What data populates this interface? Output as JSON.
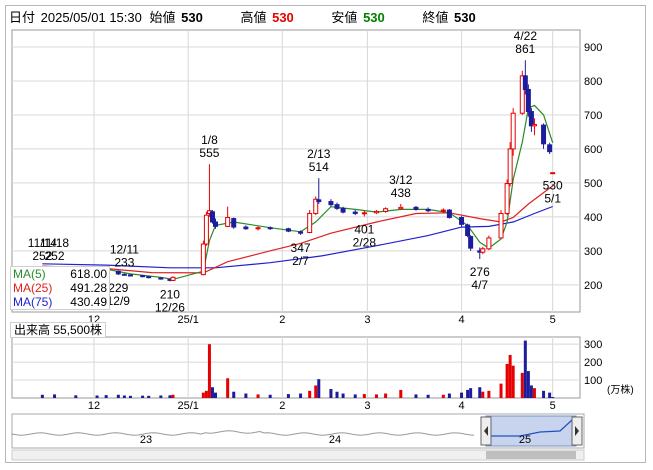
{
  "header": {
    "date_label": "日付",
    "date": "2025/05/01 15:30",
    "open_label": "始値",
    "open": "530",
    "high_label": "高値",
    "high": "530",
    "low_label": "安値",
    "low": "530",
    "close_label": "終値",
    "close": "530"
  },
  "colors": {
    "up": "#e60000",
    "down": "#1c1c9c",
    "ma5": "#2a8a2a",
    "ma25": "#e02020",
    "ma75": "#2020d0",
    "grid": "#d8d8d8",
    "volume_up": "#e60000",
    "volume_down": "#1c1c9c",
    "high_value": "#e60000",
    "low_value": "#008000"
  },
  "legend": [
    {
      "name": "MA(5)",
      "value": "618.00",
      "color": "#2a8a2a"
    },
    {
      "name": "MA(25)",
      "value": "491.28",
      "color": "#e02020"
    },
    {
      "name": "MA(75)",
      "value": "430.49",
      "color": "#2020d0"
    }
  ],
  "volume_title": "出来高 55,500株",
  "volume_unit": "(万株)",
  "navigator": {
    "labels": [
      "23",
      "24",
      "25"
    ]
  },
  "chart_data": [
    {
      "type": "candlestick",
      "title": "",
      "yticks": [
        200,
        300,
        400,
        500,
        600,
        700,
        800,
        900
      ],
      "ylim": [
        120,
        950
      ],
      "xticks": [
        {
          "label": "12",
          "x": "2024-12-01"
        },
        {
          "label": "25/1",
          "x": "2025-01-01"
        },
        {
          "label": "2",
          "x": "2025-02-01"
        },
        {
          "label": "3",
          "x": "2025-03-01"
        },
        {
          "label": "4",
          "x": "2025-04-01"
        },
        {
          "label": "5",
          "x": "2025-05-01"
        }
      ],
      "xlim": [
        "2024-11-04",
        "2025-05-10"
      ],
      "grid": true,
      "annotations": [
        {
          "date": "2024-11-14",
          "price": 252,
          "text": "11/14",
          "sub": "252"
        },
        {
          "date": "2024-11-18",
          "price": 252,
          "text": "11/18",
          "sub": "252"
        },
        {
          "date": "2024-12-11",
          "price": 233,
          "text": "12/11",
          "sub": "233"
        },
        {
          "date": "2024-12-09",
          "price": 229,
          "text": "229",
          "sub": "12/9"
        },
        {
          "date": "2024-12-26",
          "price": 210,
          "text": "210",
          "sub": "12/26"
        },
        {
          "date": "2025-01-08",
          "price": 555,
          "text": "1/8",
          "sub": "555"
        },
        {
          "date": "2025-02-07",
          "price": 347,
          "text": "347",
          "sub": "2/7"
        },
        {
          "date": "2025-02-13",
          "price": 514,
          "text": "2/13",
          "sub": "514"
        },
        {
          "date": "2025-02-28",
          "price": 401,
          "text": "401",
          "sub": "2/28"
        },
        {
          "date": "2025-03-12",
          "price": 438,
          "text": "3/12",
          "sub": "438"
        },
        {
          "date": "2025-04-07",
          "price": 276,
          "text": "276",
          "sub": "4/7"
        },
        {
          "date": "2025-04-22",
          "price": 861,
          "text": "4/22",
          "sub": "861"
        },
        {
          "date": "2025-05-01",
          "price": 530,
          "text": "530",
          "sub": "5/1"
        }
      ],
      "candles": [
        {
          "d": "2024-11-14",
          "o": 252,
          "h": 254,
          "l": 250,
          "c": 252
        },
        {
          "d": "2024-11-25",
          "o": 251,
          "h": 253,
          "l": 249,
          "c": 251
        },
        {
          "d": "2024-12-02",
          "o": 250,
          "h": 252,
          "l": 245,
          "c": 247
        },
        {
          "d": "2024-12-05",
          "o": 247,
          "h": 249,
          "l": 240,
          "c": 242
        },
        {
          "d": "2024-12-09",
          "o": 240,
          "h": 242,
          "l": 229,
          "c": 232
        },
        {
          "d": "2024-12-11",
          "o": 231,
          "h": 233,
          "l": 227,
          "c": 230
        },
        {
          "d": "2024-12-13",
          "o": 229,
          "h": 231,
          "l": 225,
          "c": 227
        },
        {
          "d": "2024-12-17",
          "o": 227,
          "h": 229,
          "l": 222,
          "c": 224
        },
        {
          "d": "2024-12-19",
          "o": 224,
          "h": 226,
          "l": 219,
          "c": 221
        },
        {
          "d": "2024-12-23",
          "o": 220,
          "h": 222,
          "l": 215,
          "c": 217
        },
        {
          "d": "2024-12-26",
          "o": 216,
          "h": 218,
          "l": 210,
          "c": 213
        },
        {
          "d": "2024-12-27",
          "o": 213,
          "h": 225,
          "l": 211,
          "c": 222
        },
        {
          "d": "2025-01-06",
          "o": 230,
          "h": 330,
          "l": 228,
          "c": 320
        },
        {
          "d": "2025-01-07",
          "o": 320,
          "h": 415,
          "l": 315,
          "c": 405
        },
        {
          "d": "2025-01-08",
          "o": 410,
          "h": 555,
          "l": 400,
          "c": 418
        },
        {
          "d": "2025-01-09",
          "o": 415,
          "h": 420,
          "l": 380,
          "c": 385
        },
        {
          "d": "2025-01-10",
          "o": 385,
          "h": 395,
          "l": 365,
          "c": 372
        },
        {
          "d": "2025-01-14",
          "o": 372,
          "h": 430,
          "l": 370,
          "c": 398
        },
        {
          "d": "2025-01-16",
          "o": 395,
          "h": 398,
          "l": 365,
          "c": 370
        },
        {
          "d": "2025-01-20",
          "o": 370,
          "h": 375,
          "l": 362,
          "c": 365
        },
        {
          "d": "2025-01-24",
          "o": 365,
          "h": 372,
          "l": 360,
          "c": 368
        },
        {
          "d": "2025-01-28",
          "o": 368,
          "h": 372,
          "l": 362,
          "c": 366
        },
        {
          "d": "2025-02-03",
          "o": 365,
          "h": 368,
          "l": 355,
          "c": 358
        },
        {
          "d": "2025-02-07",
          "o": 356,
          "h": 360,
          "l": 347,
          "c": 352
        },
        {
          "d": "2025-02-10",
          "o": 354,
          "h": 420,
          "l": 352,
          "c": 410
        },
        {
          "d": "2025-02-12",
          "o": 410,
          "h": 460,
          "l": 405,
          "c": 452
        },
        {
          "d": "2025-02-13",
          "o": 450,
          "h": 514,
          "l": 438,
          "c": 445
        },
        {
          "d": "2025-02-17",
          "o": 445,
          "h": 452,
          "l": 430,
          "c": 436
        },
        {
          "d": "2025-02-19",
          "o": 436,
          "h": 442,
          "l": 420,
          "c": 425
        },
        {
          "d": "2025-02-21",
          "o": 425,
          "h": 430,
          "l": 410,
          "c": 414
        },
        {
          "d": "2025-02-25",
          "o": 414,
          "h": 420,
          "l": 405,
          "c": 410
        },
        {
          "d": "2025-02-28",
          "o": 410,
          "h": 418,
          "l": 401,
          "c": 412
        },
        {
          "d": "2025-03-04",
          "o": 412,
          "h": 420,
          "l": 408,
          "c": 416
        },
        {
          "d": "2025-03-07",
          "o": 416,
          "h": 428,
          "l": 412,
          "c": 424
        },
        {
          "d": "2025-03-12",
          "o": 424,
          "h": 438,
          "l": 420,
          "c": 428
        },
        {
          "d": "2025-03-17",
          "o": 428,
          "h": 432,
          "l": 418,
          "c": 422
        },
        {
          "d": "2025-03-21",
          "o": 422,
          "h": 428,
          "l": 414,
          "c": 418
        },
        {
          "d": "2025-03-26",
          "o": 418,
          "h": 425,
          "l": 410,
          "c": 420
        },
        {
          "d": "2025-03-28",
          "o": 420,
          "h": 423,
          "l": 395,
          "c": 398
        },
        {
          "d": "2025-04-01",
          "o": 398,
          "h": 402,
          "l": 372,
          "c": 378
        },
        {
          "d": "2025-04-03",
          "o": 376,
          "h": 380,
          "l": 340,
          "c": 345
        },
        {
          "d": "2025-04-04",
          "o": 342,
          "h": 346,
          "l": 300,
          "c": 308
        },
        {
          "d": "2025-04-07",
          "o": 300,
          "h": 310,
          "l": 276,
          "c": 296
        },
        {
          "d": "2025-04-08",
          "o": 296,
          "h": 312,
          "l": 290,
          "c": 306
        },
        {
          "d": "2025-04-10",
          "o": 306,
          "h": 345,
          "l": 302,
          "c": 338
        },
        {
          "d": "2025-04-14",
          "o": 338,
          "h": 420,
          "l": 335,
          "c": 410
        },
        {
          "d": "2025-04-16",
          "o": 410,
          "h": 510,
          "l": 405,
          "c": 498
        },
        {
          "d": "2025-04-17",
          "o": 498,
          "h": 620,
          "l": 490,
          "c": 600
        },
        {
          "d": "2025-04-18",
          "o": 600,
          "h": 720,
          "l": 580,
          "c": 705
        },
        {
          "d": "2025-04-21",
          "o": 705,
          "h": 830,
          "l": 700,
          "c": 815
        },
        {
          "d": "2025-04-22",
          "o": 815,
          "h": 861,
          "l": 760,
          "c": 775
        },
        {
          "d": "2025-04-23",
          "o": 775,
          "h": 790,
          "l": 695,
          "c": 710
        },
        {
          "d": "2025-04-24",
          "o": 710,
          "h": 720,
          "l": 650,
          "c": 668
        },
        {
          "d": "2025-04-25",
          "o": 668,
          "h": 690,
          "l": 640,
          "c": 672
        },
        {
          "d": "2025-04-28",
          "o": 670,
          "h": 675,
          "l": 600,
          "c": 615
        },
        {
          "d": "2025-04-30",
          "o": 612,
          "h": 618,
          "l": 585,
          "c": 592
        },
        {
          "d": "2025-05-01",
          "o": 530,
          "h": 530,
          "l": 530,
          "c": 530
        }
      ],
      "ma5": [
        [
          "2024-11-14",
          252
        ],
        [
          "2024-12-05",
          246
        ],
        [
          "2024-12-13",
          232
        ],
        [
          "2024-12-23",
          222
        ],
        [
          "2024-12-27",
          216
        ],
        [
          "2025-01-06",
          240
        ],
        [
          "2025-01-08",
          330
        ],
        [
          "2025-01-10",
          375
        ],
        [
          "2025-01-16",
          385
        ],
        [
          "2025-01-28",
          368
        ],
        [
          "2025-02-07",
          356
        ],
        [
          "2025-02-12",
          385
        ],
        [
          "2025-02-17",
          430
        ],
        [
          "2025-02-25",
          422
        ],
        [
          "2025-03-04",
          414
        ],
        [
          "2025-03-12",
          422
        ],
        [
          "2025-03-21",
          422
        ],
        [
          "2025-03-28",
          412
        ],
        [
          "2025-04-03",
          375
        ],
        [
          "2025-04-07",
          325
        ],
        [
          "2025-04-10",
          308
        ],
        [
          "2025-04-14",
          335
        ],
        [
          "2025-04-16",
          385
        ],
        [
          "2025-04-18",
          510
        ],
        [
          "2025-04-21",
          620
        ],
        [
          "2025-04-23",
          720
        ],
        [
          "2025-04-25",
          728
        ],
        [
          "2025-04-28",
          700
        ],
        [
          "2025-05-01",
          618
        ]
      ],
      "ma25": [
        [
          "2024-11-14",
          255
        ],
        [
          "2024-12-05",
          248
        ],
        [
          "2024-12-20",
          236
        ],
        [
          "2025-01-06",
          235
        ],
        [
          "2025-01-14",
          268
        ],
        [
          "2025-01-28",
          300
        ],
        [
          "2025-02-07",
          322
        ],
        [
          "2025-02-17",
          352
        ],
        [
          "2025-03-04",
          385
        ],
        [
          "2025-03-17",
          410
        ],
        [
          "2025-03-28",
          412
        ],
        [
          "2025-04-07",
          395
        ],
        [
          "2025-04-14",
          385
        ],
        [
          "2025-04-18",
          398
        ],
        [
          "2025-04-23",
          438
        ],
        [
          "2025-05-01",
          491.28
        ]
      ],
      "ma75": [
        [
          "2024-11-14",
          262
        ],
        [
          "2024-12-05",
          258
        ],
        [
          "2024-12-26",
          250
        ],
        [
          "2025-01-10",
          250
        ],
        [
          "2025-01-28",
          265
        ],
        [
          "2025-02-14",
          285
        ],
        [
          "2025-03-04",
          315
        ],
        [
          "2025-03-21",
          345
        ],
        [
          "2025-04-01",
          370
        ],
        [
          "2025-04-10",
          372
        ],
        [
          "2025-04-18",
          385
        ],
        [
          "2025-04-25",
          410
        ],
        [
          "2025-05-01",
          430.49
        ]
      ]
    },
    {
      "type": "bar",
      "title": "出来高 55,500株",
      "ylabel": "(万株)",
      "yticks": [
        100,
        200,
        300
      ],
      "ylim": [
        0,
        340
      ],
      "volumes": [
        {
          "d": "2024-11-14",
          "v": 18,
          "up": false
        },
        {
          "d": "2024-11-18",
          "v": 20,
          "up": false
        },
        {
          "d": "2024-11-25",
          "v": 15,
          "up": false
        },
        {
          "d": "2024-12-02",
          "v": 14,
          "up": false
        },
        {
          "d": "2024-12-05",
          "v": 16,
          "up": false
        },
        {
          "d": "2024-12-09",
          "v": 18,
          "up": false
        },
        {
          "d": "2024-12-11",
          "v": 14,
          "up": false
        },
        {
          "d": "2024-12-13",
          "v": 12,
          "up": false
        },
        {
          "d": "2024-12-17",
          "v": 13,
          "up": false
        },
        {
          "d": "2024-12-19",
          "v": 12,
          "up": false
        },
        {
          "d": "2024-12-23",
          "v": 14,
          "up": false
        },
        {
          "d": "2024-12-26",
          "v": 15,
          "up": false
        },
        {
          "d": "2024-12-27",
          "v": 18,
          "up": true
        },
        {
          "d": "2025-01-06",
          "v": 30,
          "up": true
        },
        {
          "d": "2025-01-07",
          "v": 40,
          "up": true
        },
        {
          "d": "2025-01-08",
          "v": 300,
          "up": true
        },
        {
          "d": "2025-01-09",
          "v": 60,
          "up": false
        },
        {
          "d": "2025-01-10",
          "v": 30,
          "up": false
        },
        {
          "d": "2025-01-14",
          "v": 110,
          "up": true
        },
        {
          "d": "2025-01-16",
          "v": 35,
          "up": false
        },
        {
          "d": "2025-01-20",
          "v": 25,
          "up": false
        },
        {
          "d": "2025-01-24",
          "v": 20,
          "up": true
        },
        {
          "d": "2025-01-28",
          "v": 18,
          "up": false
        },
        {
          "d": "2025-02-03",
          "v": 22,
          "up": false
        },
        {
          "d": "2025-02-07",
          "v": 25,
          "up": false
        },
        {
          "d": "2025-02-10",
          "v": 40,
          "up": true
        },
        {
          "d": "2025-02-12",
          "v": 70,
          "up": true
        },
        {
          "d": "2025-02-13",
          "v": 105,
          "up": false
        },
        {
          "d": "2025-02-17",
          "v": 50,
          "up": false
        },
        {
          "d": "2025-02-19",
          "v": 35,
          "up": false
        },
        {
          "d": "2025-02-21",
          "v": 25,
          "up": false
        },
        {
          "d": "2025-02-25",
          "v": 20,
          "up": false
        },
        {
          "d": "2025-02-28",
          "v": 22,
          "up": true
        },
        {
          "d": "2025-03-04",
          "v": 20,
          "up": true
        },
        {
          "d": "2025-03-07",
          "v": 25,
          "up": true
        },
        {
          "d": "2025-03-12",
          "v": 45,
          "up": true
        },
        {
          "d": "2025-03-17",
          "v": 20,
          "up": false
        },
        {
          "d": "2025-03-21",
          "v": 18,
          "up": false
        },
        {
          "d": "2025-03-26",
          "v": 18,
          "up": true
        },
        {
          "d": "2025-03-28",
          "v": 25,
          "up": false
        },
        {
          "d": "2025-04-01",
          "v": 30,
          "up": false
        },
        {
          "d": "2025-04-03",
          "v": 45,
          "up": false
        },
        {
          "d": "2025-04-04",
          "v": 55,
          "up": false
        },
        {
          "d": "2025-04-07",
          "v": 60,
          "up": false
        },
        {
          "d": "2025-04-08",
          "v": 35,
          "up": true
        },
        {
          "d": "2025-04-10",
          "v": 40,
          "up": true
        },
        {
          "d": "2025-04-14",
          "v": 80,
          "up": true
        },
        {
          "d": "2025-04-16",
          "v": 190,
          "up": true
        },
        {
          "d": "2025-04-17",
          "v": 240,
          "up": true
        },
        {
          "d": "2025-04-18",
          "v": 180,
          "up": true
        },
        {
          "d": "2025-04-21",
          "v": 140,
          "up": true
        },
        {
          "d": "2025-04-22",
          "v": 320,
          "up": false
        },
        {
          "d": "2025-04-23",
          "v": 150,
          "up": false
        },
        {
          "d": "2025-04-24",
          "v": 70,
          "up": false
        },
        {
          "d": "2025-04-25",
          "v": 55,
          "up": true
        },
        {
          "d": "2025-04-28",
          "v": 40,
          "up": false
        },
        {
          "d": "2025-04-30",
          "v": 30,
          "up": false
        },
        {
          "d": "2025-05-01",
          "v": 5.55,
          "up": false
        }
      ]
    }
  ]
}
